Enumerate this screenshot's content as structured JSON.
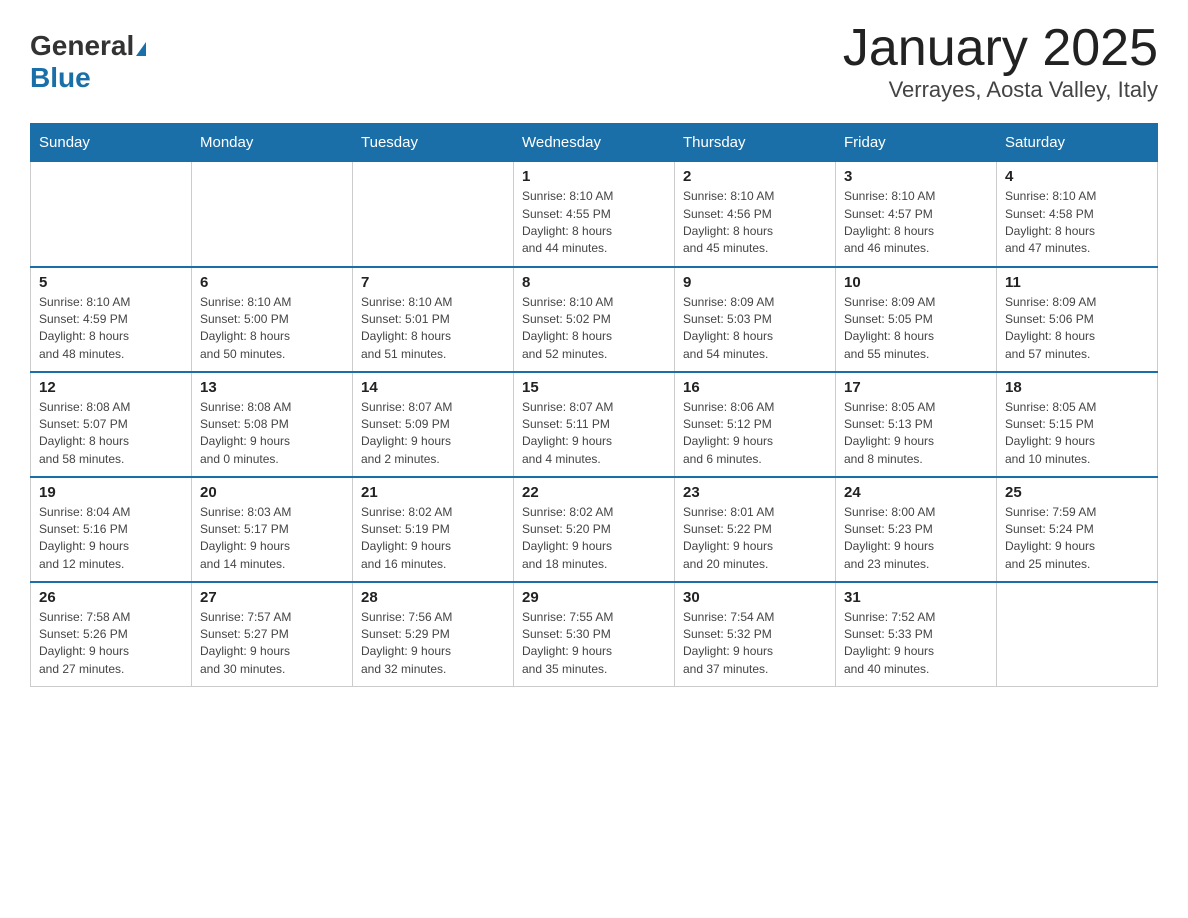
{
  "header": {
    "logo_general": "General",
    "logo_blue": "Blue",
    "title": "January 2025",
    "subtitle": "Verrayes, Aosta Valley, Italy"
  },
  "days_of_week": [
    "Sunday",
    "Monday",
    "Tuesday",
    "Wednesday",
    "Thursday",
    "Friday",
    "Saturday"
  ],
  "weeks": [
    [
      {
        "day": "",
        "info": ""
      },
      {
        "day": "",
        "info": ""
      },
      {
        "day": "",
        "info": ""
      },
      {
        "day": "1",
        "info": "Sunrise: 8:10 AM\nSunset: 4:55 PM\nDaylight: 8 hours\nand 44 minutes."
      },
      {
        "day": "2",
        "info": "Sunrise: 8:10 AM\nSunset: 4:56 PM\nDaylight: 8 hours\nand 45 minutes."
      },
      {
        "day": "3",
        "info": "Sunrise: 8:10 AM\nSunset: 4:57 PM\nDaylight: 8 hours\nand 46 minutes."
      },
      {
        "day": "4",
        "info": "Sunrise: 8:10 AM\nSunset: 4:58 PM\nDaylight: 8 hours\nand 47 minutes."
      }
    ],
    [
      {
        "day": "5",
        "info": "Sunrise: 8:10 AM\nSunset: 4:59 PM\nDaylight: 8 hours\nand 48 minutes."
      },
      {
        "day": "6",
        "info": "Sunrise: 8:10 AM\nSunset: 5:00 PM\nDaylight: 8 hours\nand 50 minutes."
      },
      {
        "day": "7",
        "info": "Sunrise: 8:10 AM\nSunset: 5:01 PM\nDaylight: 8 hours\nand 51 minutes."
      },
      {
        "day": "8",
        "info": "Sunrise: 8:10 AM\nSunset: 5:02 PM\nDaylight: 8 hours\nand 52 minutes."
      },
      {
        "day": "9",
        "info": "Sunrise: 8:09 AM\nSunset: 5:03 PM\nDaylight: 8 hours\nand 54 minutes."
      },
      {
        "day": "10",
        "info": "Sunrise: 8:09 AM\nSunset: 5:05 PM\nDaylight: 8 hours\nand 55 minutes."
      },
      {
        "day": "11",
        "info": "Sunrise: 8:09 AM\nSunset: 5:06 PM\nDaylight: 8 hours\nand 57 minutes."
      }
    ],
    [
      {
        "day": "12",
        "info": "Sunrise: 8:08 AM\nSunset: 5:07 PM\nDaylight: 8 hours\nand 58 minutes."
      },
      {
        "day": "13",
        "info": "Sunrise: 8:08 AM\nSunset: 5:08 PM\nDaylight: 9 hours\nand 0 minutes."
      },
      {
        "day": "14",
        "info": "Sunrise: 8:07 AM\nSunset: 5:09 PM\nDaylight: 9 hours\nand 2 minutes."
      },
      {
        "day": "15",
        "info": "Sunrise: 8:07 AM\nSunset: 5:11 PM\nDaylight: 9 hours\nand 4 minutes."
      },
      {
        "day": "16",
        "info": "Sunrise: 8:06 AM\nSunset: 5:12 PM\nDaylight: 9 hours\nand 6 minutes."
      },
      {
        "day": "17",
        "info": "Sunrise: 8:05 AM\nSunset: 5:13 PM\nDaylight: 9 hours\nand 8 minutes."
      },
      {
        "day": "18",
        "info": "Sunrise: 8:05 AM\nSunset: 5:15 PM\nDaylight: 9 hours\nand 10 minutes."
      }
    ],
    [
      {
        "day": "19",
        "info": "Sunrise: 8:04 AM\nSunset: 5:16 PM\nDaylight: 9 hours\nand 12 minutes."
      },
      {
        "day": "20",
        "info": "Sunrise: 8:03 AM\nSunset: 5:17 PM\nDaylight: 9 hours\nand 14 minutes."
      },
      {
        "day": "21",
        "info": "Sunrise: 8:02 AM\nSunset: 5:19 PM\nDaylight: 9 hours\nand 16 minutes."
      },
      {
        "day": "22",
        "info": "Sunrise: 8:02 AM\nSunset: 5:20 PM\nDaylight: 9 hours\nand 18 minutes."
      },
      {
        "day": "23",
        "info": "Sunrise: 8:01 AM\nSunset: 5:22 PM\nDaylight: 9 hours\nand 20 minutes."
      },
      {
        "day": "24",
        "info": "Sunrise: 8:00 AM\nSunset: 5:23 PM\nDaylight: 9 hours\nand 23 minutes."
      },
      {
        "day": "25",
        "info": "Sunrise: 7:59 AM\nSunset: 5:24 PM\nDaylight: 9 hours\nand 25 minutes."
      }
    ],
    [
      {
        "day": "26",
        "info": "Sunrise: 7:58 AM\nSunset: 5:26 PM\nDaylight: 9 hours\nand 27 minutes."
      },
      {
        "day": "27",
        "info": "Sunrise: 7:57 AM\nSunset: 5:27 PM\nDaylight: 9 hours\nand 30 minutes."
      },
      {
        "day": "28",
        "info": "Sunrise: 7:56 AM\nSunset: 5:29 PM\nDaylight: 9 hours\nand 32 minutes."
      },
      {
        "day": "29",
        "info": "Sunrise: 7:55 AM\nSunset: 5:30 PM\nDaylight: 9 hours\nand 35 minutes."
      },
      {
        "day": "30",
        "info": "Sunrise: 7:54 AM\nSunset: 5:32 PM\nDaylight: 9 hours\nand 37 minutes."
      },
      {
        "day": "31",
        "info": "Sunrise: 7:52 AM\nSunset: 5:33 PM\nDaylight: 9 hours\nand 40 minutes."
      },
      {
        "day": "",
        "info": ""
      }
    ]
  ]
}
